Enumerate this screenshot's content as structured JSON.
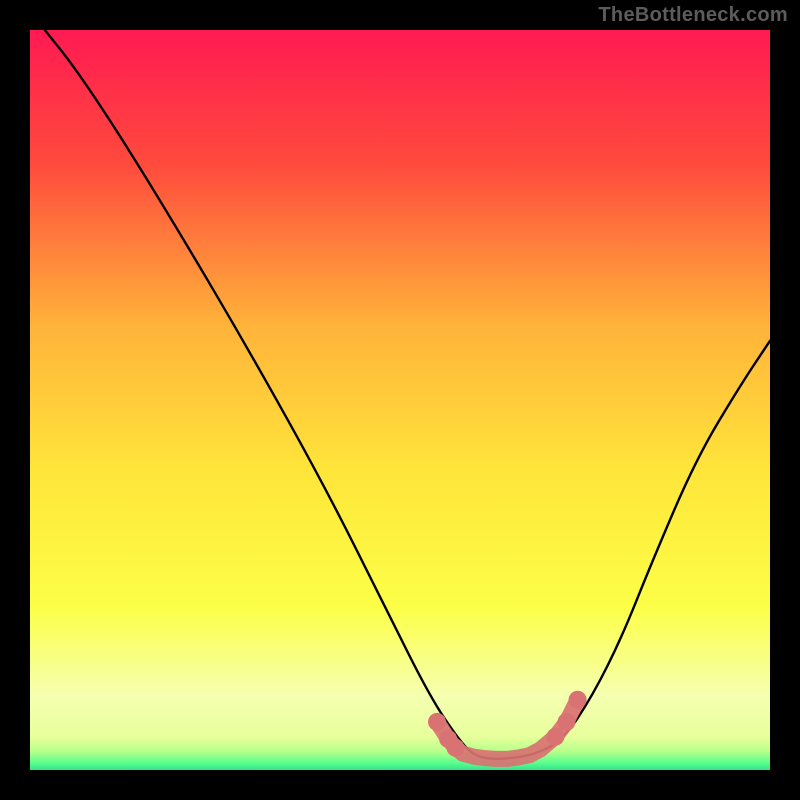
{
  "watermark": "TheBottleneck.com",
  "chart_data": {
    "type": "line",
    "title": "",
    "xlabel": "",
    "ylabel": "",
    "xlim": [
      0,
      100
    ],
    "ylim": [
      0,
      100
    ],
    "grid": false,
    "legend": null,
    "background_gradient": {
      "stops": [
        {
          "offset": 0.0,
          "color": "#ff1a52"
        },
        {
          "offset": 0.18,
          "color": "#ff4a3d"
        },
        {
          "offset": 0.4,
          "color": "#ffb33a"
        },
        {
          "offset": 0.6,
          "color": "#ffe63a"
        },
        {
          "offset": 0.78,
          "color": "#fcff47"
        },
        {
          "offset": 0.9,
          "color": "#f5ffb0"
        },
        {
          "offset": 0.955,
          "color": "#e8ff9c"
        },
        {
          "offset": 0.975,
          "color": "#b6ff8a"
        },
        {
          "offset": 0.99,
          "color": "#5bff8e"
        },
        {
          "offset": 1.0,
          "color": "#34e28a"
        }
      ]
    },
    "series": [
      {
        "name": "bottleneck-curve",
        "stroke": "#000000",
        "x": [
          2,
          6,
          12,
          20,
          30,
          40,
          48,
          54,
          58,
          60,
          62,
          64,
          68,
          72,
          76,
          80,
          84,
          90,
          96,
          100
        ],
        "y": [
          100,
          95,
          86,
          73,
          56,
          38,
          22,
          10,
          4,
          2,
          1.5,
          1.5,
          2,
          4,
          10,
          18,
          28,
          42,
          52,
          58
        ]
      },
      {
        "name": "optimal-zone-highlight",
        "stroke": "#d97272",
        "type": "scatter",
        "x": [
          55,
          56.5,
          57.5,
          58.5,
          60,
          61.5,
          63,
          64.5,
          66,
          67.5,
          69,
          71,
          72.5,
          74
        ],
        "y": [
          6.5,
          4.2,
          3.0,
          2.2,
          1.8,
          1.6,
          1.5,
          1.5,
          1.7,
          2.0,
          2.8,
          4.5,
          6.5,
          9.5
        ]
      }
    ]
  }
}
